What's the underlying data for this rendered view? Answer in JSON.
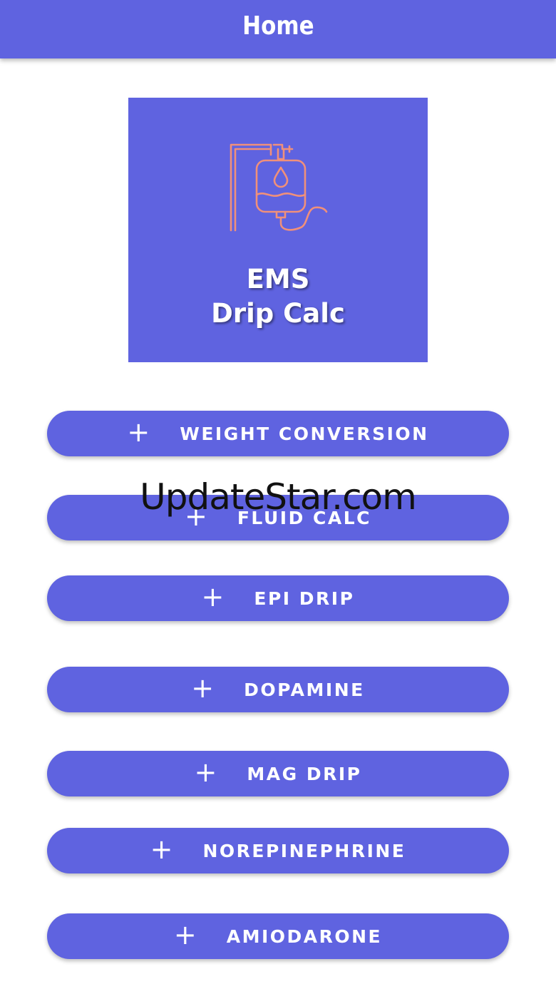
{
  "header": {
    "title": "Home"
  },
  "logo": {
    "line1": "EMS",
    "line2": "Drip Calc",
    "icon": "iv-bag-icon"
  },
  "buttons": [
    {
      "icon": "plus",
      "label": "WEIGHT CONVERSION"
    },
    {
      "icon": "plus",
      "label": "FLUID CALC"
    },
    {
      "icon": "plus",
      "label": "EPI DRIP"
    },
    {
      "icon": "plus",
      "label": "DOPAMINE"
    },
    {
      "icon": "plus",
      "label": "MAG DRIP"
    },
    {
      "icon": "plus",
      "label": "NOREPINEPHRINE"
    },
    {
      "icon": "plus",
      "label": "AMIODARONE"
    }
  ],
  "watermark": {
    "text": "UpdateStar.com"
  },
  "colors": {
    "primary": "#5f63e0",
    "icon_stroke": "#f0907a",
    "background": "#ffffff"
  }
}
